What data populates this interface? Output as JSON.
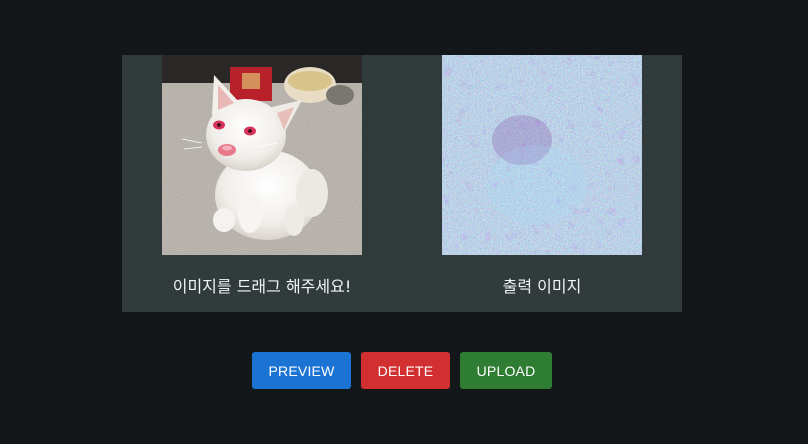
{
  "panel": {
    "input_image": {
      "alt": "white kitten",
      "caption": "이미지를 드래그 해주세요!"
    },
    "output_image": {
      "alt": "processed image",
      "caption": "출력 이미지"
    }
  },
  "buttons": {
    "preview_label": "PREVIEW",
    "delete_label": "DELETE",
    "upload_label": "UPLOAD"
  },
  "colors": {
    "background": "#131719",
    "panel": "#313b3c",
    "preview": "#1b74d4",
    "delete": "#d12f30",
    "upload": "#2e7d32"
  }
}
